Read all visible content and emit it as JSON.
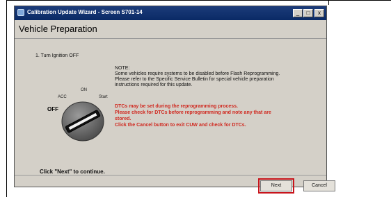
{
  "window": {
    "title": "Calibration Update Wizard - Screen S701-14",
    "controls": {
      "minimize": "_",
      "maximize": "□",
      "close": "x"
    }
  },
  "page": {
    "title": "Vehicle Preparation"
  },
  "step": {
    "text": "1. Turn Ignition OFF"
  },
  "ignition": {
    "labels": {
      "acc": "ACC",
      "on": "ON",
      "start": "Start",
      "off": "OFF"
    }
  },
  "note": {
    "heading": "NOTE:",
    "lines": [
      "Some vehicles require systems to be disabled before Flash Reprogramming.",
      "Please refer to the Specific Service Bulletin for special vehicle preparation",
      "instructions required for this update."
    ]
  },
  "warning": {
    "color": "#d0271e",
    "lines": [
      "DTCs may be set during the reprogramming process.",
      "Please check for DTCs before reprogramming and note any that are",
      "stored.",
      "Click the Cancel button to exit CUW and check for DTCs."
    ]
  },
  "footer": {
    "prompt": "Click \"Next\" to continue.",
    "next_label": "Next",
    "cancel_label": "Cancel",
    "highlight_color": "#c8141b"
  }
}
